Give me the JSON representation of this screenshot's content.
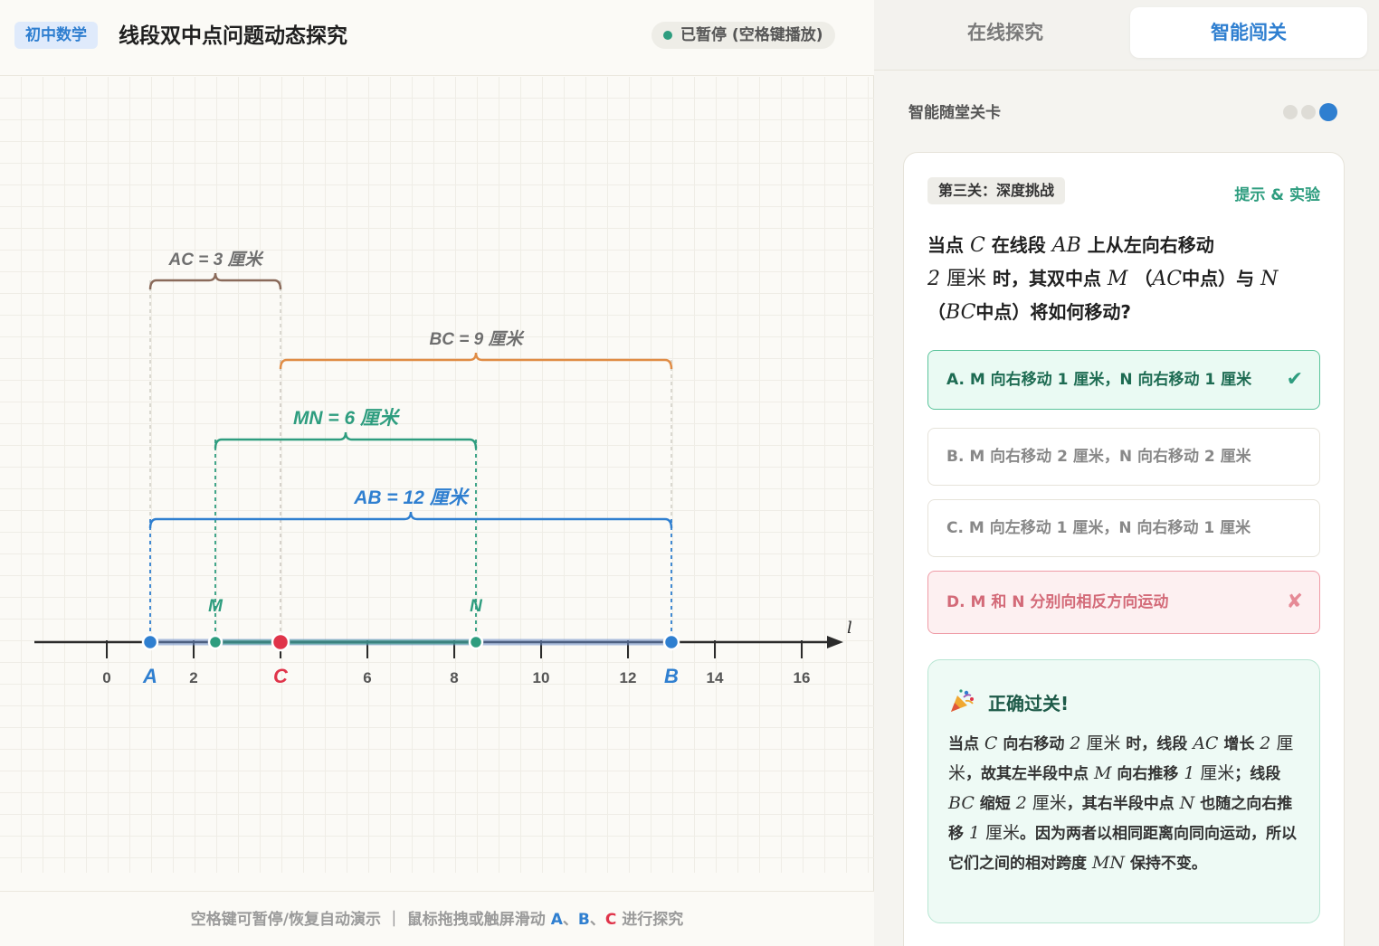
{
  "header": {
    "badge": "初中数学",
    "title": "线段双中点问题动态探究",
    "status": "已暂停 (空格键播放)"
  },
  "footer": {
    "hint_prefix": "空格键可暂停/恢复自动演示 ｜ 鼠标拖拽或触屏滑动",
    "point_a": "A",
    "sep1": "、",
    "point_b": "B",
    "sep2": "、",
    "point_c": "C",
    "hint_suffix": "进行探究"
  },
  "tabs": [
    {
      "label": "在线探究",
      "active": false
    },
    {
      "label": "智能闯关",
      "active": true
    }
  ],
  "levels": {
    "label": "智能随堂关卡",
    "count": 3,
    "active_index": 2
  },
  "card": {
    "level_chip": "第三关：深度挑战",
    "hint_link": "提示 & 实验",
    "question": {
      "p1": "当点",
      "v1": "C",
      "p2": "在线段",
      "v2": "AB",
      "p3": "上从左向右移动",
      "v3": "2",
      "p4": "厘米",
      "p5": "时，其双中点",
      "v4": "M",
      "p6": "（",
      "v5": "AC",
      "p7": "中点）与",
      "v6": "N",
      "p8": "（",
      "v7": "BC",
      "p9": "中点）将如何移动?"
    },
    "options": [
      {
        "label": "A. M 向右移动 1 厘米，N 向右移动 1 厘米",
        "state": "correct",
        "mark": "✔"
      },
      {
        "label": "B. M 向右移动 2 厘米，N 向右移动 2 厘米",
        "state": "neutral",
        "mark": ""
      },
      {
        "label": "C. M 向左移动 1 厘米，N 向右移动 1 厘米",
        "state": "neutral",
        "mark": ""
      },
      {
        "label": "D. M 和 N 分别向相反方向运动",
        "state": "wrong",
        "mark": "✘"
      }
    ],
    "result": {
      "title": "正确过关!",
      "t1": "当点",
      "v1": "C",
      "t2": "向右移动",
      "v2": "2",
      "t3": "厘米",
      "t4": "时，线段",
      "v3": "AC",
      "t5": "增长",
      "v4": "2",
      "t6": "厘米",
      "t7": "，故其左半段中点",
      "v5": "M",
      "t8": "向右推移",
      "v6": "1",
      "t9": "厘米",
      "t10": "；线段",
      "v7": "BC",
      "t11": "缩短",
      "v8": "2",
      "t12": "厘米",
      "t13": "，其右半段中点",
      "v9": "N",
      "t14": "也随之向右推移",
      "v10": "1",
      "t15": "厘米",
      "t16": "。因为两者以相同距离向同向运动，所以它们之间的相对跨度",
      "v11": "MN",
      "t17": "保持不变。"
    }
  },
  "number_line": {
    "axis_label": "l",
    "ticks": [
      0,
      2,
      4,
      6,
      8,
      10,
      12,
      14,
      16
    ],
    "tick_labels_shown": [
      "0",
      "2",
      "6",
      "8",
      "10",
      "12",
      "14",
      "16"
    ],
    "points": [
      {
        "name": "A",
        "value": 1,
        "color": "#2f7fd0"
      },
      {
        "name": "M",
        "value": 2.5,
        "color": "#2e9d7f"
      },
      {
        "name": "C",
        "value": 4,
        "color": "#e0344a"
      },
      {
        "name": "N",
        "value": 8.5,
        "color": "#2e9d7f"
      },
      {
        "name": "B",
        "value": 13,
        "color": "#2f7fd0"
      }
    ],
    "segments": [
      {
        "label": "AC = 3 厘米",
        "from": 1,
        "to": 4,
        "color": "#8a6a5a",
        "level": 0
      },
      {
        "label": "BC = 9 厘米",
        "from": 4,
        "to": 13,
        "color": "#e08c45",
        "level": 1
      },
      {
        "label": "MN = 6 厘米",
        "from": 2.5,
        "to": 8.5,
        "color": "#2e9d7f",
        "level": 2
      },
      {
        "label": "AB = 12 厘米",
        "from": 1,
        "to": 13,
        "color": "#2f7fd0",
        "level": 3
      }
    ]
  }
}
